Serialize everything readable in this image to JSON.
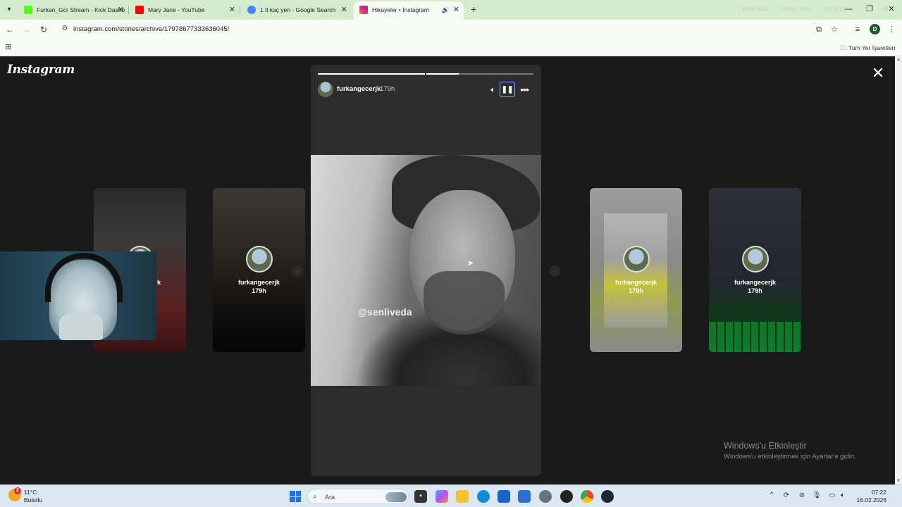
{
  "browser": {
    "tabs": [
      {
        "title": "Furkan_Gcr Stream - Kick Dashb",
        "favicon_color": "#53fc18"
      },
      {
        "title": "Mary Jane - YouTube",
        "favicon_color": "#ff0000"
      },
      {
        "title": "1 tl kaç yen - Google Search",
        "favicon_color": "#4285f4"
      },
      {
        "title": "Hikayeler • Instagram",
        "favicon_color": "#e1306c"
      }
    ],
    "new_tab_symbol": "+",
    "sysmon": {
      "fps": "FPS N/A",
      "gpu": "GPU 15%",
      "cpu": "CPU 16%",
      "extra": "N/A"
    },
    "url": "instagram.com/stories/archive/17978677333636045/",
    "profile_initial": "D",
    "bookmark_folder": "Tüm Yer İşaretleri"
  },
  "instagram": {
    "logo": "Instagram",
    "main_story": {
      "username": "furkangecerjk",
      "time": "179h",
      "watermark": "@senliveda",
      "progress": [
        1.0,
        0.3,
        0.0
      ]
    },
    "side_stories": [
      {
        "username": "k",
        "time": "",
        "bg": "linear-gradient(180deg,#2a2a2a 0%,#3a3a3a 30%,#5a1e1e 75%,#3a1212 100%)"
      },
      {
        "username": "furkangecerjk",
        "time": "179h",
        "bg": "linear-gradient(180deg,#3b3a34 0%,#2a2520 40%,#0d0d0d 80%,#050505 100%)"
      },
      {
        "username": "furkangecerjk",
        "time": "179h",
        "bg": "linear-gradient(180deg,#9c9c9c 0%,#8a8a8a 45%,#8d9a52 70%,#8a8a8a 100%)"
      },
      {
        "username": "furkangecerjk",
        "time": "179h",
        "bg": "linear-gradient(180deg,#2e2e38 0%,#252530 55%,#0d3a1a 80%,#0d6b25 100%)"
      }
    ]
  },
  "activation": {
    "title": "Windows'u Etkinleştir",
    "subtitle": "Windows'u etkinleştirmek için Ayarlar'a gidin."
  },
  "taskbar": {
    "weather_temp": "11°C",
    "weather_desc": "Bulutlu",
    "weather_badge": "2",
    "search_placeholder": "Ara",
    "time": "07:22",
    "date": "16.02.2026"
  }
}
